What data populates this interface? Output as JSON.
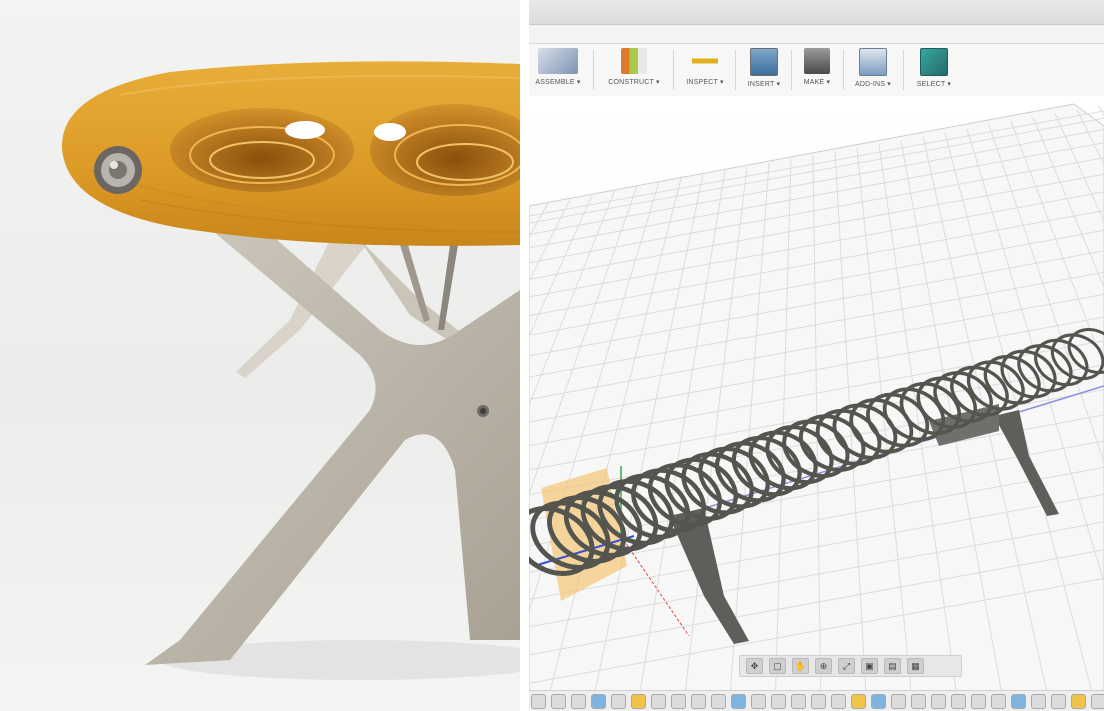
{
  "toolbar": {
    "groups": [
      {
        "label": "ASSEMBLE ▾",
        "color": "#5b7fa8"
      },
      {
        "label": "CONSTRUCT ▾",
        "color": "#e07a2a"
      },
      {
        "label": "INSPECT ▾",
        "color": "#e0b020"
      },
      {
        "label": "INSERT ▾",
        "color": "#3c6f9c"
      },
      {
        "label": "MAKE ▾",
        "color": "#4a4a4a"
      },
      {
        "label": "ADD-INS ▾",
        "color": "#3a6fa6"
      },
      {
        "label": "SELECT ▾",
        "color": "#2a8a86"
      }
    ]
  },
  "colors": {
    "wood": "#e2a12b",
    "wood_dark": "#b46f12",
    "metal": "#bdb6ab",
    "cad_model": "#6b6b68",
    "selection_fill": "#f4c36a",
    "grid": "#d6d6d6"
  },
  "navbar": {
    "icons": [
      "orbit-icon",
      "look-at-icon",
      "pan-icon",
      "zoom-icon",
      "fit-icon",
      "display-icon",
      "visual-style-icon",
      "grid-icon"
    ]
  },
  "timeline": {
    "count": 32
  }
}
